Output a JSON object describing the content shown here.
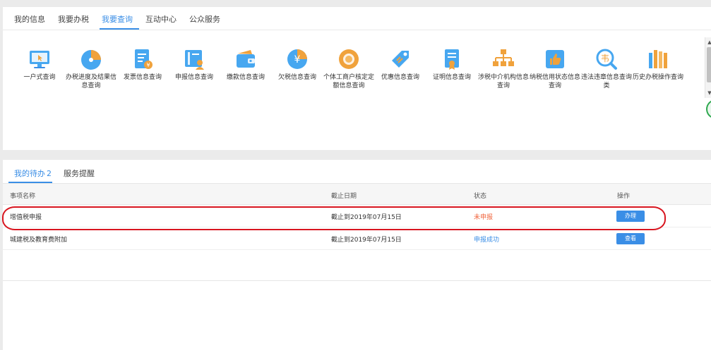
{
  "tabs": [
    {
      "label": "我的信息"
    },
    {
      "label": "我要办税"
    },
    {
      "label": "我要查询"
    },
    {
      "label": "互动中心"
    },
    {
      "label": "公众服务"
    }
  ],
  "query_items": [
    {
      "label": "一户式查询",
      "icon": "monitor-icon"
    },
    {
      "label": "办税进度及结果信息查询",
      "icon": "pie-chart-icon"
    },
    {
      "label": "发票信息查询",
      "icon": "invoice-icon"
    },
    {
      "label": "申报信息查询",
      "icon": "book-person-icon"
    },
    {
      "label": "缴款信息查询",
      "icon": "wallet-icon"
    },
    {
      "label": "欠税信息查询",
      "icon": "yuan-coin-icon"
    },
    {
      "label": "个体工商户核定定额信息查询",
      "icon": "shop-icon"
    },
    {
      "label": "优惠信息查询",
      "icon": "tag-icon"
    },
    {
      "label": "证明信息查询",
      "icon": "certificate-icon"
    },
    {
      "label": "涉税中介机构信息查询",
      "icon": "org-chart-icon"
    },
    {
      "label": "纳税信用状态信息查询",
      "icon": "thumbs-up-icon"
    },
    {
      "label": "违法违章信息查询类",
      "icon": "search-violation-icon"
    },
    {
      "label": "历史办税操作查询",
      "icon": "history-icon"
    }
  ],
  "todo_tabs": {
    "todo_label": "我的待办",
    "todo_count": "2",
    "reminder_label": "服务提醒"
  },
  "table": {
    "headers": {
      "name": "事项名称",
      "deadline": "截止日期",
      "status": "状态",
      "action": "操作"
    },
    "rows": [
      {
        "name": "增值税申报",
        "deadline": "截止到2019年07月15日",
        "status": "未申报",
        "action": "办理"
      },
      {
        "name": "城建税及教育费附加",
        "deadline": "截止到2019年07月15日",
        "status": "申报成功",
        "action": "查看"
      }
    ]
  },
  "colors": {
    "accent": "#3a8ee6",
    "status_pending": "#f0643c",
    "highlight": "#d8151f"
  }
}
